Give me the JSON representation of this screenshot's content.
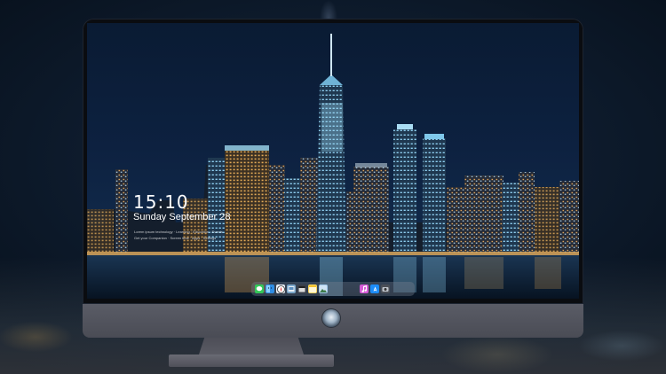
{
  "lock_screen": {
    "time": "15:10",
    "date": "Sunday September 28",
    "hint_line_1": "Lorem ipsum technology · Learning · Education · Events",
    "hint_line_2": "Get your Companion · Screen time · Apps · Settings"
  },
  "dock": {
    "items": [
      {
        "name": "messages",
        "icon": "messages-icon",
        "color": "#34c759"
      },
      {
        "name": "finder",
        "icon": "finder-icon",
        "color": "#2f8de4"
      },
      {
        "name": "safari",
        "icon": "safari-icon",
        "color": "#e9eef5"
      },
      {
        "name": "preview",
        "icon": "preview-icon",
        "color": "#7aa6c9"
      },
      {
        "name": "final-cut",
        "icon": "clapper-icon",
        "color": "#3a3f49"
      },
      {
        "name": "notes",
        "icon": "notes-icon",
        "color": "#f4d35e"
      },
      {
        "name": "photos",
        "icon": "photos-icon",
        "color": "#9ec5e8"
      },
      {
        "name": "itunes",
        "icon": "music-icon",
        "color": "#d45ad6"
      },
      {
        "name": "app-store",
        "icon": "app-store-icon",
        "color": "#1d8cf8"
      },
      {
        "name": "camera",
        "icon": "camera-icon",
        "color": "#4b4f57"
      }
    ]
  },
  "colors": {
    "bezel": "#0a0c10",
    "chin": "#5a5c66",
    "sky": "#0d2140",
    "lights": "#e7b25c",
    "tower_glow": "#8fd0f2"
  }
}
